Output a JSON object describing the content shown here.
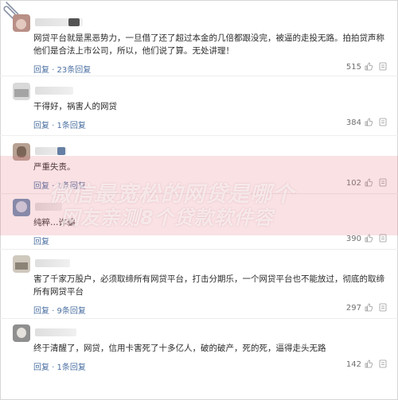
{
  "watermark": {
    "line1": "微信最宽松的网贷是哪个",
    "line2": "网友亲测8个贷款软件容"
  },
  "comments": [
    {
      "text": "网贷平台就是黑恶势力，一旦借了还了超过本金的几倍都跟没完，被逼的走投无路。拍拍贷声称他们是合法上市公司，所以，他们说了算。无处讲理！",
      "reply": "回复 · 23条回复",
      "likes": "515"
    },
    {
      "text": "干得好，祸害人的网贷",
      "reply": "回复 · 1条回复",
      "likes": "384"
    },
    {
      "text": "严重失责。",
      "reply": "回复 · 1条回复",
      "likes": "102"
    },
    {
      "text": "纯粹…诈骗",
      "reply": "回复",
      "likes": "390"
    },
    {
      "text": "害了千家万股户，必须取缔所有网贷平台，打击分期乐，一个网贷平台也不能放过，彻底的取缔所有网贷平台",
      "reply": "回复 · 9条回复",
      "likes": "297"
    },
    {
      "text": "终于清醒了，网贷，信用卡害死了十多亿人，破的破产，死的死，逼得走头无路",
      "reply": "回复 · 1条回复",
      "likes": "142"
    }
  ]
}
